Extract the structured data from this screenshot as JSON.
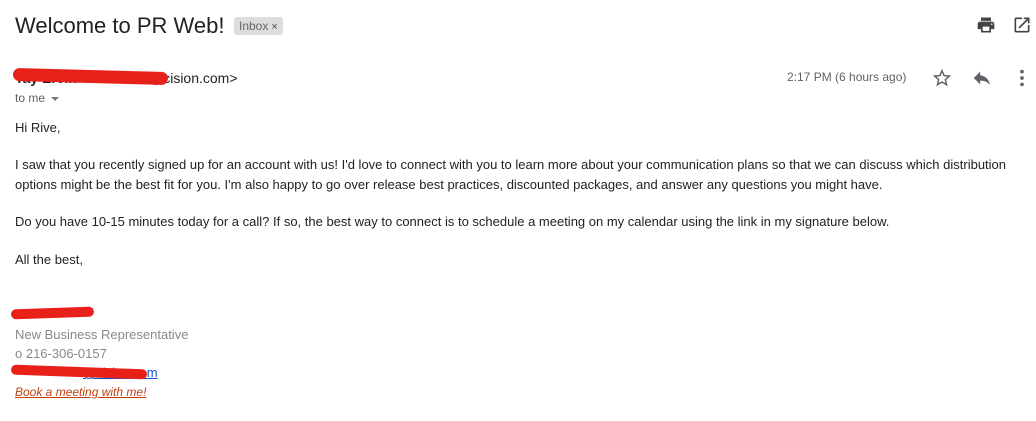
{
  "email": {
    "subject": "Welcome to PR Web!",
    "label": "Inbox",
    "label_close": "×",
    "sender_name": "Tay      Ervin",
    "sender_email_suffix": "@cision.com>",
    "to_line": "to me",
    "date": "2:17 PM (6 hours ago)",
    "body": [
      "Hi Rive,",
      "I saw that you recently signed up for an account with us! I'd love to connect with you to learn more about your communication plans so that we can discuss which distribution options might be the best fit for you. I'm also happy to go over release best practices, discounted packages, and answer any questions you might have.",
      "Do you have 10-15 minutes today for a call? If so, the best way to connect is to schedule a meeting on my calendar using the link in my signature below.",
      "All the best,"
    ],
    "signature": {
      "title": "New Business Representative",
      "phone": "o 216-306-0157",
      "email_suffix": "@cision.com",
      "meeting_link": "Book a meeting with me!"
    }
  },
  "icons": {
    "print": "print-icon",
    "open_new_window": "open-in-new-icon",
    "star": "star-icon",
    "reply": "reply-icon",
    "more": "more-vert-icon"
  },
  "colors": {
    "redaction": "#e8201a",
    "link": "#1155cc",
    "meeting_link": "#c1410f",
    "chip_bg": "#dddddd"
  }
}
